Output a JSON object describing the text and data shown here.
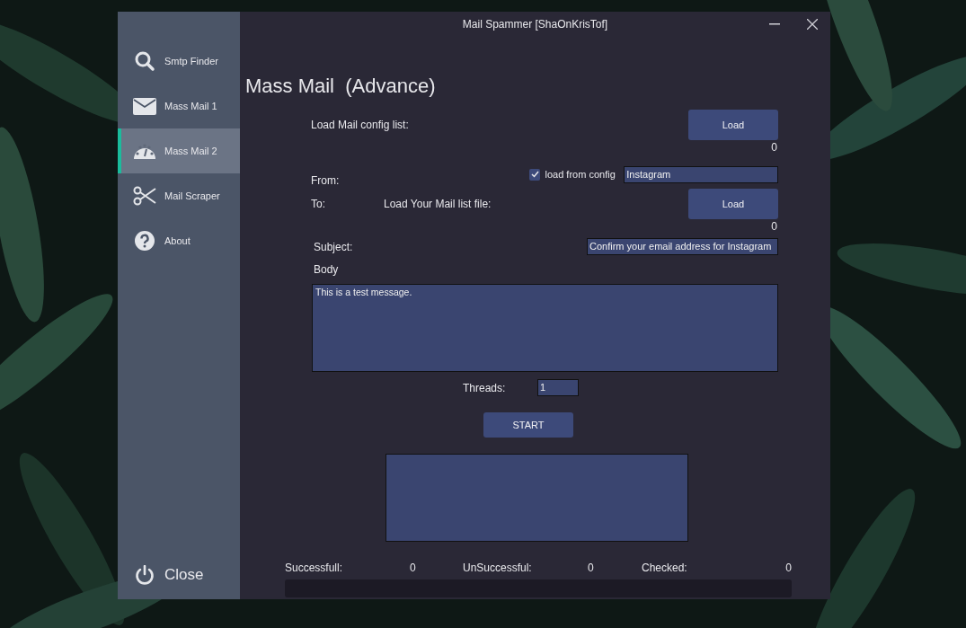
{
  "window": {
    "title": "Mail Spammer [ShaOnKrisTof]"
  },
  "sidebar": {
    "items": [
      {
        "label": "Smtp Finder",
        "kind": "search",
        "selected": false
      },
      {
        "label": "Mass Mail 1",
        "kind": "envelope",
        "selected": false
      },
      {
        "label": "Mass Mail 2",
        "kind": "gauge",
        "selected": true
      },
      {
        "label": "Mail Scraper",
        "kind": "scissors",
        "selected": false
      },
      {
        "label": "About",
        "kind": "question",
        "selected": false
      }
    ],
    "close": "Close"
  },
  "page": {
    "title": "Mass Mail  (Advance)",
    "config": {
      "label": "Load Mail config list:",
      "button": "Load",
      "count": "0"
    },
    "from": {
      "label": "From:",
      "checkbox_label": "load from config",
      "checked": true,
      "value": "Instagram"
    },
    "to": {
      "label": "To:",
      "file_label": "Load Your Mail list file:",
      "button": "Load",
      "count": "0"
    },
    "subject": {
      "label": "Subject:",
      "value": "Confirm your email address for Instagram"
    },
    "body": {
      "label": "Body",
      "value": "This is a test message."
    },
    "threads": {
      "label": "Threads:",
      "value": "1"
    },
    "start": "START",
    "stats": [
      {
        "label": "Successfull:",
        "value": "0"
      },
      {
        "label": "UnSuccessful:",
        "value": "0"
      },
      {
        "label": "Checked:",
        "value": "0"
      }
    ],
    "progress": {
      "level": 0
    }
  }
}
